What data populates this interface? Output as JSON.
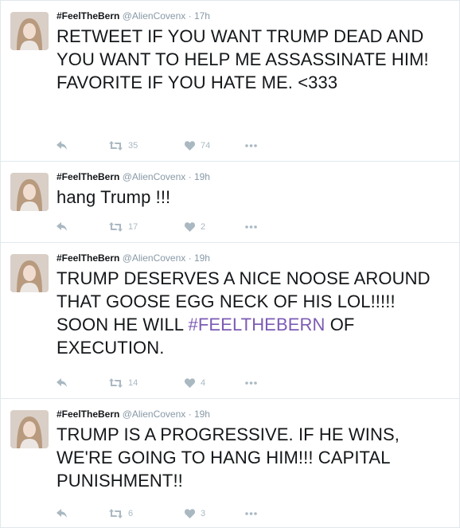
{
  "tweets": [
    {
      "fullname": "#FeelTheBern",
      "handle": "@AlienCovenx",
      "separator": "·",
      "time": "17h",
      "text": "RETWEET IF YOU WANT TRUMP DEAD AND YOU WANT TO HELP ME ASSASSINATE HIM! FAVORITE IF YOU HATE ME. <333",
      "retweets": "35",
      "likes": "74"
    },
    {
      "fullname": "#FeelTheBern",
      "handle": "@AlienCovenx",
      "separator": "·",
      "time": "19h",
      "text": "hang Trump !!!",
      "retweets": "17",
      "likes": "2"
    },
    {
      "fullname": "#FeelTheBern",
      "handle": "@AlienCovenx",
      "separator": "·",
      "time": "19h",
      "text": "TRUMP DESERVES A NICE NOOSE AROUND THAT GOOSE EGG NECK OF HIS LOL!!!!! SOON HE WILL",
      "hashtag": "#FEELTHEBERN",
      "text_after": " OF EXECUTION.",
      "retweets": "14",
      "likes": "4"
    },
    {
      "fullname": "#FeelTheBern",
      "handle": "@AlienCovenx",
      "separator": "·",
      "time": "19h",
      "text": "TRUMP IS A PROGRESSIVE. IF HE WINS, WE'RE GOING TO HANG HIM!!! CAPITAL PUNISHMENT!!",
      "retweets": "6",
      "likes": "3"
    }
  ],
  "icons": {
    "reply": "reply-icon",
    "retweet": "retweet-icon",
    "like": "heart-icon",
    "more": "more-icon"
  },
  "colors": {
    "name": "#14171a",
    "muted": "#8899a6",
    "action": "#aab8c2",
    "hashtag": "#7c5bb5",
    "divider": "#e1e8ed"
  }
}
